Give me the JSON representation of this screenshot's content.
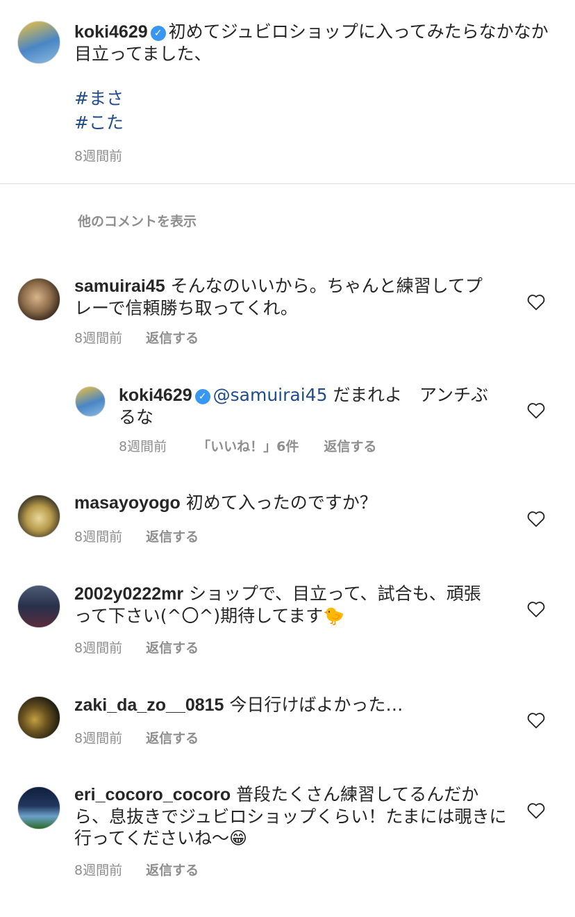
{
  "caption": {
    "avatar": "koki4629-avatar",
    "username": "koki4629",
    "verified": true,
    "text_line1": "初めてジュビロショップに入ってみたらなかなか",
    "text_line2": "目立ってました、",
    "hashtags": [
      "#まさ",
      "#こた"
    ],
    "time": "8週間前"
  },
  "load_more": "他のコメントを表示",
  "comments": [
    {
      "username": "samuirai45",
      "line1": "そんなのいいから。ちゃんと練習してプ",
      "line2": "レーで信頼勝ち取ってくれ。",
      "time": "8週間前",
      "reply_label": "返信する",
      "replies": [
        {
          "username": "koki4629",
          "verified": true,
          "mention": "@samuirai45",
          "line1": "だまれよ　アンチぶ",
          "line2": "るな",
          "time": "8週間前",
          "likes": "「いいね！」6件",
          "reply_label": "返信する"
        }
      ]
    },
    {
      "username": "masayoyogo",
      "line1": "初めて入ったのですか？",
      "time": "8週間前",
      "reply_label": "返信する"
    },
    {
      "username": "2002y0222mr",
      "line1": "ショップで、目立って、試合も、頑張",
      "line2": "って下さい(^〇^)期待してます🐤",
      "time": "8週間前",
      "reply_label": "返信する"
    },
    {
      "username": "zaki_da_zo__0815",
      "line1": "今日行けばよかった…",
      "time": "8週間前",
      "reply_label": "返信する"
    },
    {
      "username": "eri_cocoro_cocoro",
      "line1": "普段たくさん練習してるんだか",
      "line2": "ら、息抜きでジュビロショップくらい！たまには覗きに",
      "line3": "行ってくださいね〜😁",
      "time": "8週間前",
      "reply_label": "返信する"
    }
  ],
  "colors": {
    "text": "#262626",
    "meta": "#8e8e8e",
    "hashtag": "#1f4d8c",
    "verified": "#3897f0",
    "divider": "#dbdbdb"
  }
}
